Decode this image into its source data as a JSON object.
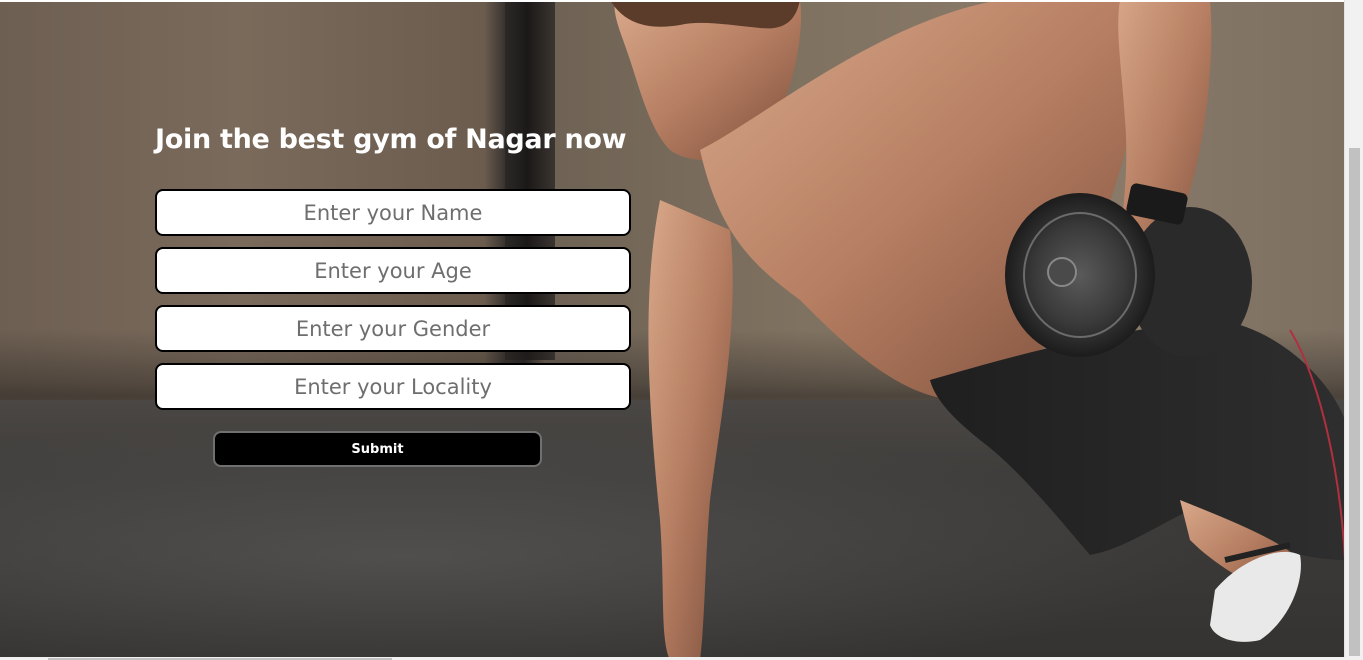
{
  "page": {
    "accent": "#000000",
    "background_subject": "athlete-doing-dumbbell-row-plank"
  },
  "form": {
    "heading": "Join the best gym of Nagar now",
    "fields": [
      {
        "placeholder": "Enter your Name",
        "value": ""
      },
      {
        "placeholder": "Enter your Age",
        "value": ""
      },
      {
        "placeholder": "Enter your Gender",
        "value": ""
      },
      {
        "placeholder": "Enter your Locality",
        "value": ""
      }
    ],
    "submit_label": "Submit"
  }
}
